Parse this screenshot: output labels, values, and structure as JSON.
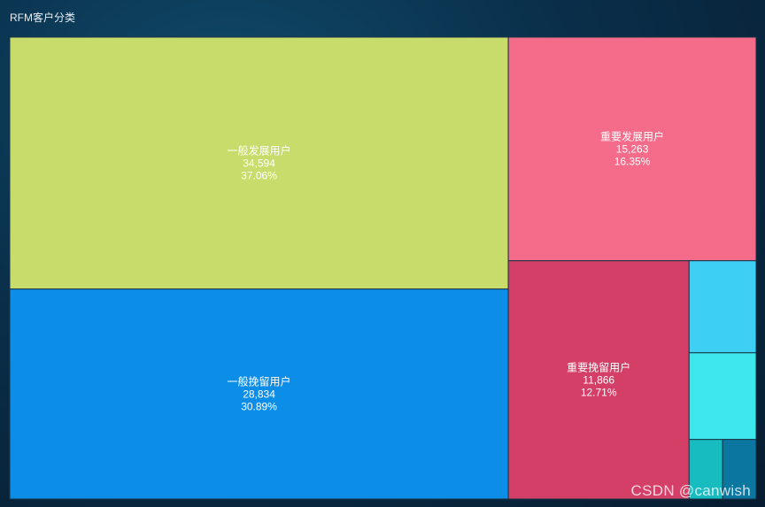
{
  "title": "RFM客户分类",
  "watermark": "CSDN @canwish",
  "chart_data": {
    "type": "treemap",
    "title": "RFM客户分类",
    "items": [
      {
        "name": "一般发展用户",
        "value": 34594,
        "value_label": "34,594",
        "percent": "37.06%",
        "color": "#c8dc6b"
      },
      {
        "name": "一般挽留用户",
        "value": 28834,
        "value_label": "28,834",
        "percent": "30.89%",
        "color": "#0b8de8"
      },
      {
        "name": "重要发展用户",
        "value": 15263,
        "value_label": "15,263",
        "percent": "16.35%",
        "color": "#f56b8a"
      },
      {
        "name": "重要挽留用户",
        "value": 11866,
        "value_label": "11,866",
        "percent": "12.71%",
        "color": "#d43f67"
      },
      {
        "name": "",
        "value": 1700,
        "value_label": "",
        "percent": "",
        "color": "#3ecff5"
      },
      {
        "name": "",
        "value": 1600,
        "value_label": "",
        "percent": "",
        "color": "#3de8ec"
      },
      {
        "name": "",
        "value": 550,
        "value_label": "",
        "percent": "",
        "color": "#16bcc0"
      },
      {
        "name": "",
        "value": 550,
        "value_label": "",
        "percent": "",
        "color": "#0b77a0"
      }
    ]
  }
}
